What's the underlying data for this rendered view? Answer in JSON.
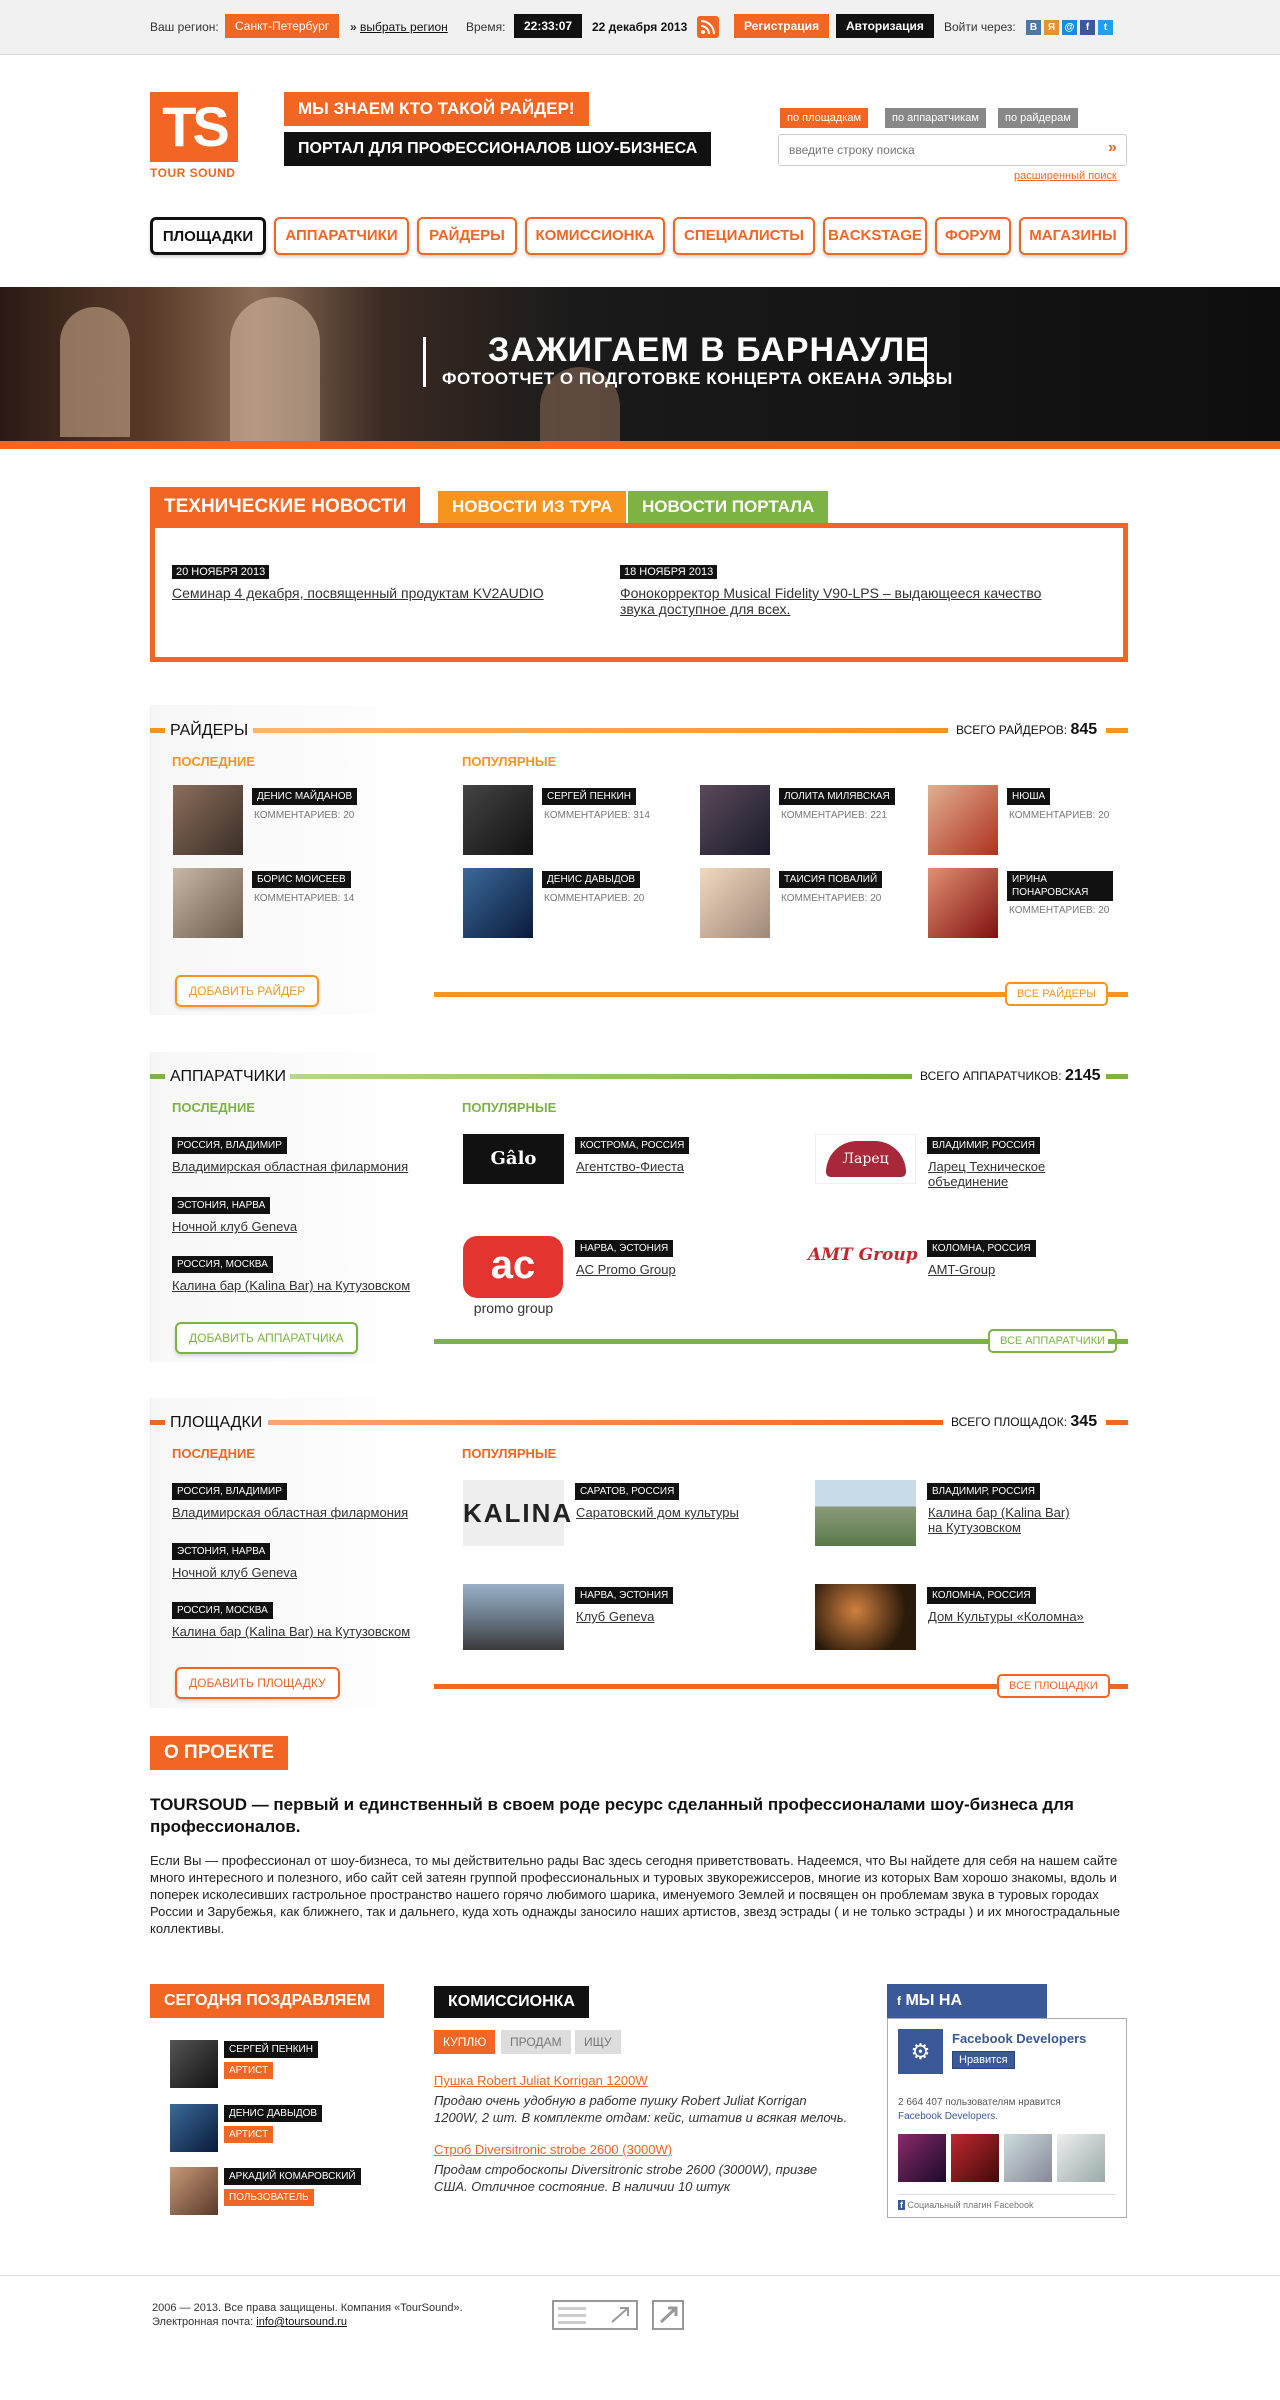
{
  "topbar": {
    "region_label": "Ваш регион:",
    "region": "Санкт-Петербург",
    "choose_region": "выбрать регион",
    "time_label": "Время:",
    "time": "22:33:07",
    "date": "22 декабря 2013",
    "register": "Регистрация",
    "login": "Авторизация",
    "login_via": "Войти через:",
    "social": [
      "В",
      "Я",
      "@",
      "f",
      "t"
    ]
  },
  "header": {
    "logo": "TS",
    "logo_sub": "TOUR SOUND",
    "slogan1": "МЫ ЗНАЕМ КТО ТАКОЙ РАЙДЕР!",
    "slogan2": "ПОРТАЛ ДЛЯ ПРОФЕССИОНАЛОВ ШОУ-БИЗНЕСА",
    "search_tabs": [
      "по площадкам",
      "по аппаратчикам",
      "по райдерам"
    ],
    "search_placeholder": "введите строку поиска",
    "search_go": "»",
    "advanced": "расширенный поиск"
  },
  "nav": [
    "ПЛОЩАДКИ",
    "АППАРАТЧИКИ",
    "РАЙДЕРЫ",
    "КОМИССИОНКА",
    "СПЕЦИАЛИСТЫ",
    "BACKSTAGE",
    "ФОРУМ",
    "МАГАЗИНЫ"
  ],
  "banner": {
    "title": "ЗАЖИГАЕМ В БАРНАУЛЕ",
    "subtitle": "ФОТООТЧЕТ О ПОДГОТОВКЕ КОНЦЕРТА ОКЕАНА ЭЛЬЗЫ"
  },
  "news": {
    "tabs": [
      "ТЕХНИЧЕСКИЕ НОВОСТИ",
      "НОВОСТИ ИЗ ТУРА",
      "НОВОСТИ ПОРТАЛА"
    ],
    "items": [
      {
        "date": "20 НОЯБРЯ 2013",
        "title": "Семинар 4 декабря, посвященный продуктам KV2AUDIO"
      },
      {
        "date": "18 НОЯБРЯ 2013",
        "title": "Фонокорректор Musical Fidelity V90-LPS – выдающееся качество звука доступное для всех."
      }
    ]
  },
  "riders": {
    "title": "РАЙДЕРЫ",
    "total_label": "ВСЕГО РАЙДЕРОВ:",
    "total": "845",
    "latest_label": "ПОСЛЕДНИЕ",
    "popular_label": "ПОПУЛЯРНЫЕ",
    "latest": [
      {
        "name": "ДЕНИС МАЙДАНОВ",
        "comments": "КОММЕНТАРИЕВ: 20"
      },
      {
        "name": "БОРИС МОИСЕЕВ",
        "comments": "КОММЕНТАРИЕВ: 14"
      }
    ],
    "popular": [
      {
        "name": "СЕРГЕЙ ПЕНКИН",
        "comments": "КОММЕНТАРИЕВ: 314"
      },
      {
        "name": "ЛОЛИТА МИЛЯВСКАЯ",
        "comments": "КОММЕНТАРИЕВ: 221"
      },
      {
        "name": "НЮША",
        "comments": "КОММЕНТАРИЕВ: 20"
      },
      {
        "name": "ДЕНИС ДАВЫДОВ",
        "comments": "КОММЕНТАРИЕВ: 20"
      },
      {
        "name": "ТАИСИЯ ПОВАЛИЙ",
        "comments": "КОММЕНТАРИЕВ: 20"
      },
      {
        "name": "ИРИНА ПОНАРОВСКАЯ",
        "comments": "КОММЕНТАРИЕВ: 20"
      }
    ],
    "add": "ДОБАВИТЬ РАЙДЕР",
    "all": "ВСЕ РАЙДЕРЫ"
  },
  "crews": {
    "title": "АППАРАТЧИКИ",
    "total_label": "ВСЕГО АППАРАТЧИКОВ:",
    "total": "2145",
    "latest_label": "ПОСЛЕДНИЕ",
    "popular_label": "ПОПУЛЯРНЫЕ",
    "latest": [
      {
        "place": "РОССИЯ, ВЛАДИМИР",
        "name": "Владимирская областная филармония"
      },
      {
        "place": "ЭСТОНИЯ, НАРВА",
        "name": "Ночной клуб Geneva"
      },
      {
        "place": "РОССИЯ, МОСКВА",
        "name": "Калина бар (Kalina Bar)  на Кутузовском"
      }
    ],
    "popular": [
      {
        "place": "КОСТРОМА, РОССИЯ",
        "name": "Агентство-Фиеста",
        "logo": "Gâlo"
      },
      {
        "place": "ВЛАДИМИР, РОССИЯ",
        "name": "Ларец Техническое объединение",
        "logo": "Ларец"
      },
      {
        "place": "НАРВА, ЭСТОНИЯ",
        "name": "AC Promo Group",
        "logo": "ac",
        "logo_sub": "promo group"
      },
      {
        "place": "КОЛОМНА, РОССИЯ",
        "name": "AMT-Group",
        "logo": "AMT Group"
      }
    ],
    "add": "ДОБАВИТЬ АППАРАТЧИКА",
    "all": "ВСЕ АППАРАТЧИКИ"
  },
  "venues": {
    "title": "ПЛОЩАДКИ",
    "total_label": "ВСЕГО ПЛОЩАДОК:",
    "total": "345",
    "latest_label": "ПОСЛЕДНИЕ",
    "popular_label": "ПОПУЛЯРНЫЕ",
    "latest": [
      {
        "place": "РОССИЯ, ВЛАДИМИР",
        "name": "Владимирская областная филармония"
      },
      {
        "place": "ЭСТОНИЯ, НАРВА",
        "name": "Ночной клуб Geneva"
      },
      {
        "place": "РОССИЯ, МОСКВА",
        "name": "Калина бар (Kalina Bar)  на Кутузовском"
      }
    ],
    "popular": [
      {
        "place": "САРАТОВ, РОССИЯ",
        "name": "Саратовский дом культуры",
        "logo": "KALINA"
      },
      {
        "place": "ВЛАДИМИР, РОССИЯ",
        "name": "Калина бар (Kalina Bar) на Кутузовском"
      },
      {
        "place": "НАРВА, ЭСТОНИЯ",
        "name": "Клуб Geneva"
      },
      {
        "place": "КОЛОМНА, РОССИЯ",
        "name": "Дом Культуры «Коломна»"
      }
    ],
    "add": "ДОБАВИТЬ ПЛОЩАДКУ",
    "all": "ВСЕ ПЛОЩАДКИ"
  },
  "about": {
    "title": "О ПРОЕКТЕ",
    "lead": "TOURSOUD — первый и единственный в своем роде ресурс сделанный профессионалами шоу-бизнеса для профессионалов.",
    "body": "Если Вы — профессионал от шоу-бизнеса, то мы действительно рады Вас здесь сегодня приветствовать. Надеемся, что Вы найдете для себя на нашем сайте много интересного и полезного, ибо сайт сей затеян группой профессиональных и туровых звукорежиссеров, многие из которых Вам хорошо знакомы, вдоль и поперек исколесивших гастрольное пространство нашего горячо любимого шарика, именуемого Землей и посвящен он проблемам звука в туровых городах России и Зарубежья, как ближнего, так и дальнего, куда хоть однажды заносило наших артистов, звезд эстрады ( и не только эстрады ) и их многострадальные коллективы."
  },
  "congrats": {
    "title": "СЕГОДНЯ ПОЗДРАВЛЯЕМ",
    "people": [
      {
        "name": "СЕРГЕЙ ПЕНКИН",
        "role": "АРТИСТ"
      },
      {
        "name": "ДЕНИС ДАВЫДОВ",
        "role": "АРТИСТ"
      },
      {
        "name": "АРКАДИЙ КОМАРОВСКИЙ",
        "role": "ПОЛЬЗОВАТЕЛЬ"
      }
    ]
  },
  "market": {
    "title": "КОМИССИОНКА",
    "tabs": [
      "КУПЛЮ",
      "ПРОДАМ",
      "ИЩУ"
    ],
    "items": [
      {
        "title": "Пушка Robert Juliat Korrigan 1200W",
        "text": "Продаю очень удобную в работе пушку Robert Juliat Korrigan 1200W, 2 шт. В комплекте отдам: кейс, штатив и всякая мелочь."
      },
      {
        "title": "Строб Diversitronic strobe 2600 (3000W)",
        "text": "Продам стробоскопы Diversitronic strobe 2600 (3000W), призве США. Отличное состояние. В наличии 10 штук"
      }
    ]
  },
  "facebook": {
    "title": "МЫ НА FACEBOOK",
    "page": "Facebook Developers",
    "like": "Нравится",
    "count": "2 664 407 пользователям нравится",
    "count_link": "Facebook Developers.",
    "plugin": "Социальный плагин Facebook"
  },
  "footer": {
    "copyright": "2006 — 2013.  Все права защищены. Компания «TourSound».",
    "email_label": "Электронная почта:",
    "email": "info@toursound.ru"
  },
  "colors": {
    "orange": "#f26522",
    "green": "#7cb342",
    "black": "#111111",
    "fb": "#3b5998"
  }
}
